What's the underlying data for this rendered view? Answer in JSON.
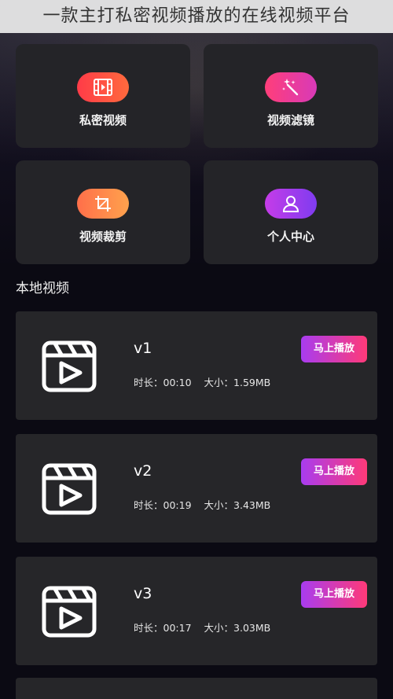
{
  "banner": {
    "title": "一款主打私密视频播放的在线视频平台"
  },
  "tiles": [
    {
      "label": "私密视频",
      "icon": "film-icon",
      "color": "#ff4a45"
    },
    {
      "label": "视频滤镜",
      "icon": "magic-wand-icon",
      "color": "#f03d95"
    },
    {
      "label": "视频裁剪",
      "icon": "crop-icon",
      "color": "#ff8a4c"
    },
    {
      "label": "个人中心",
      "icon": "user-icon",
      "color": "#a43ceb"
    }
  ],
  "section": {
    "title": "本地视频"
  },
  "videos": [
    {
      "name": "v1",
      "duration_label": "时长：00:10",
      "size_label": "大小：1.59MB",
      "action": "马上播放"
    },
    {
      "name": "v2",
      "duration_label": "时长：00:19",
      "size_label": "大小：3.43MB",
      "action": "马上播放"
    },
    {
      "name": "v3",
      "duration_label": "时长：00:17",
      "size_label": "大小：3.03MB",
      "action": "马上播放"
    }
  ],
  "colors": {
    "background": "#0b0a13",
    "card": "#262629",
    "play_button_start": "#a83cf0",
    "play_button_end": "#ff3a78"
  }
}
